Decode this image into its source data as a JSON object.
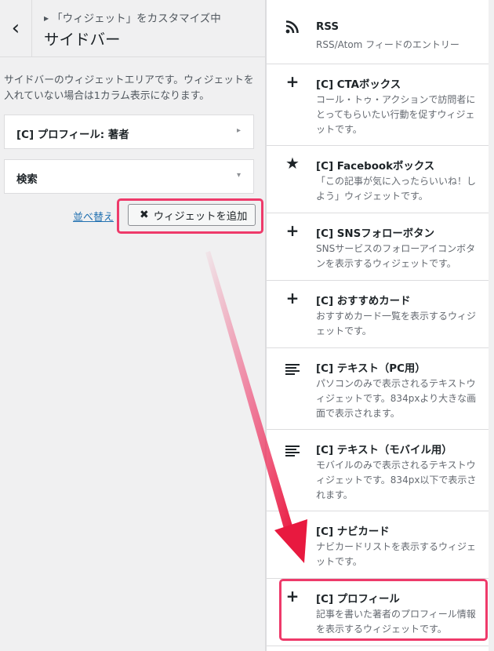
{
  "header": {
    "breadcrumb": "「ウィジェット」をカスタマイズ中",
    "title": "サイドバー",
    "back_glyph": "‹"
  },
  "sidebar": {
    "description": "サイドバーのウィジェットエリアです。ウィジェットを入れていない場合は1カラム表示になります。",
    "widgets": [
      {
        "title": "[C] プロフィール: 著者",
        "arrow": "▸"
      },
      {
        "title": "検索",
        "arrow": "▾"
      }
    ],
    "reorder_label": "並べ替え",
    "add_button_label": "ウィジェットを追加",
    "add_button_icon": "✖"
  },
  "available_widgets": [
    {
      "icon": "rss-icon",
      "title": "RSS",
      "desc": "RSS/Atom フィードのエントリー"
    },
    {
      "icon": "plus-icon",
      "title": "[C] CTAボックス",
      "desc": "コール・トゥ・アクションで訪問者にとってもらいたい行動を促すウィジェットです。"
    },
    {
      "icon": "star-icon",
      "title": "[C] Facebookボックス",
      "desc": "「この記事が気に入ったらいいね！しよう」ウィジェットです。"
    },
    {
      "icon": "plus-icon",
      "title": "[C] SNSフォローボタン",
      "desc": "SNSサービスのフォローアイコンボタンを表示するウィジェットです。"
    },
    {
      "icon": "plus-icon",
      "title": "[C] おすすめカード",
      "desc": "おすすめカード一覧を表示するウィジェットです。"
    },
    {
      "icon": "text-icon",
      "title": "[C] テキスト（PC用）",
      "desc": "パソコンのみで表示されるテキストウィジェットです。834pxより大きな画面で表示されます。"
    },
    {
      "icon": "text-icon",
      "title": "[C] テキスト（モバイル用）",
      "desc": "モバイルのみで表示されるテキストウィジェットです。834px以下で表示されます。"
    },
    {
      "icon": "text-icon",
      "title": "[C] ナビカード",
      "desc": "ナビカードリストを表示するウィジェットです。"
    },
    {
      "icon": "plus-icon",
      "title": "[C] プロフィール",
      "desc": "記事を書いた著者のプロフィール情報を表示するウィジェットです。"
    }
  ],
  "colors": {
    "highlight": "#ee3a6a",
    "link": "#2271b1"
  }
}
